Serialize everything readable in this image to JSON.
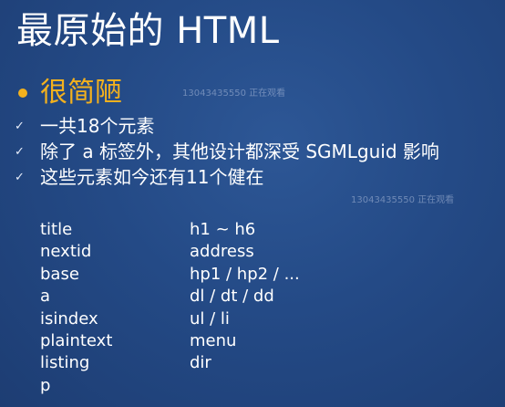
{
  "slide": {
    "title": "最原始的 HTML",
    "heading": "很简陋",
    "watermarks": [
      "13043435550 正在观看",
      "13043435550 正在观看"
    ],
    "points": [
      "一共18个元素",
      "除了 a 标签外，其他设计都深受 SGMLguid 影响",
      "这些元素如今还有11个健在"
    ],
    "check_glyph": "✓",
    "elements_left": [
      "title",
      "nextid",
      "base",
      "a",
      "isindex",
      "plaintext",
      "listing",
      "p"
    ],
    "elements_right": [
      "h1 ~ h6",
      "address",
      "hp1 / hp2 / ...",
      "dl / dt / dd",
      "ul / li",
      "menu",
      "dir"
    ],
    "colors": {
      "background": "#244a86",
      "accent": "#f3b11e",
      "text": "#ffffff"
    }
  }
}
